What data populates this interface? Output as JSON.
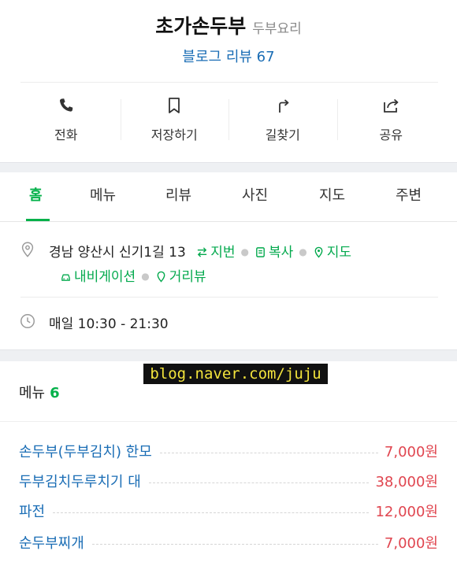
{
  "place": {
    "name": "초가손두부",
    "category": "두부요리",
    "review_link": "블로그 리뷰 67"
  },
  "actions": [
    {
      "label": "전화",
      "icon": "phone-icon"
    },
    {
      "label": "저장하기",
      "icon": "bookmark-icon"
    },
    {
      "label": "길찾기",
      "icon": "directions-icon"
    },
    {
      "label": "공유",
      "icon": "share-icon"
    }
  ],
  "tabs": [
    "홈",
    "메뉴",
    "리뷰",
    "사진",
    "지도",
    "주변"
  ],
  "active_tab": "홈",
  "address": {
    "text": "경남 양산시 신기1길 13",
    "links": {
      "jibun": "지번",
      "copy": "복사",
      "map": "지도",
      "navigation": "내비게이션",
      "streetview": "거리뷰"
    }
  },
  "hours": {
    "text": "매일 10:30 - 21:30"
  },
  "watermark": "blog.naver.com/juju",
  "menu": {
    "heading": "메뉴",
    "count": "6",
    "items": [
      {
        "name": "손두부(두부김치) 한모",
        "price": "7,000원"
      },
      {
        "name": "두부김치두루치기 대",
        "price": "38,000원"
      },
      {
        "name": "파전",
        "price": "12,000원"
      },
      {
        "name": "순두부찌개",
        "price": "7,000원"
      }
    ]
  },
  "colors": {
    "accent_green": "#03b14a",
    "link_blue": "#1a6db5",
    "price_red": "#e0454f",
    "section_gap": "#eef0f3"
  }
}
